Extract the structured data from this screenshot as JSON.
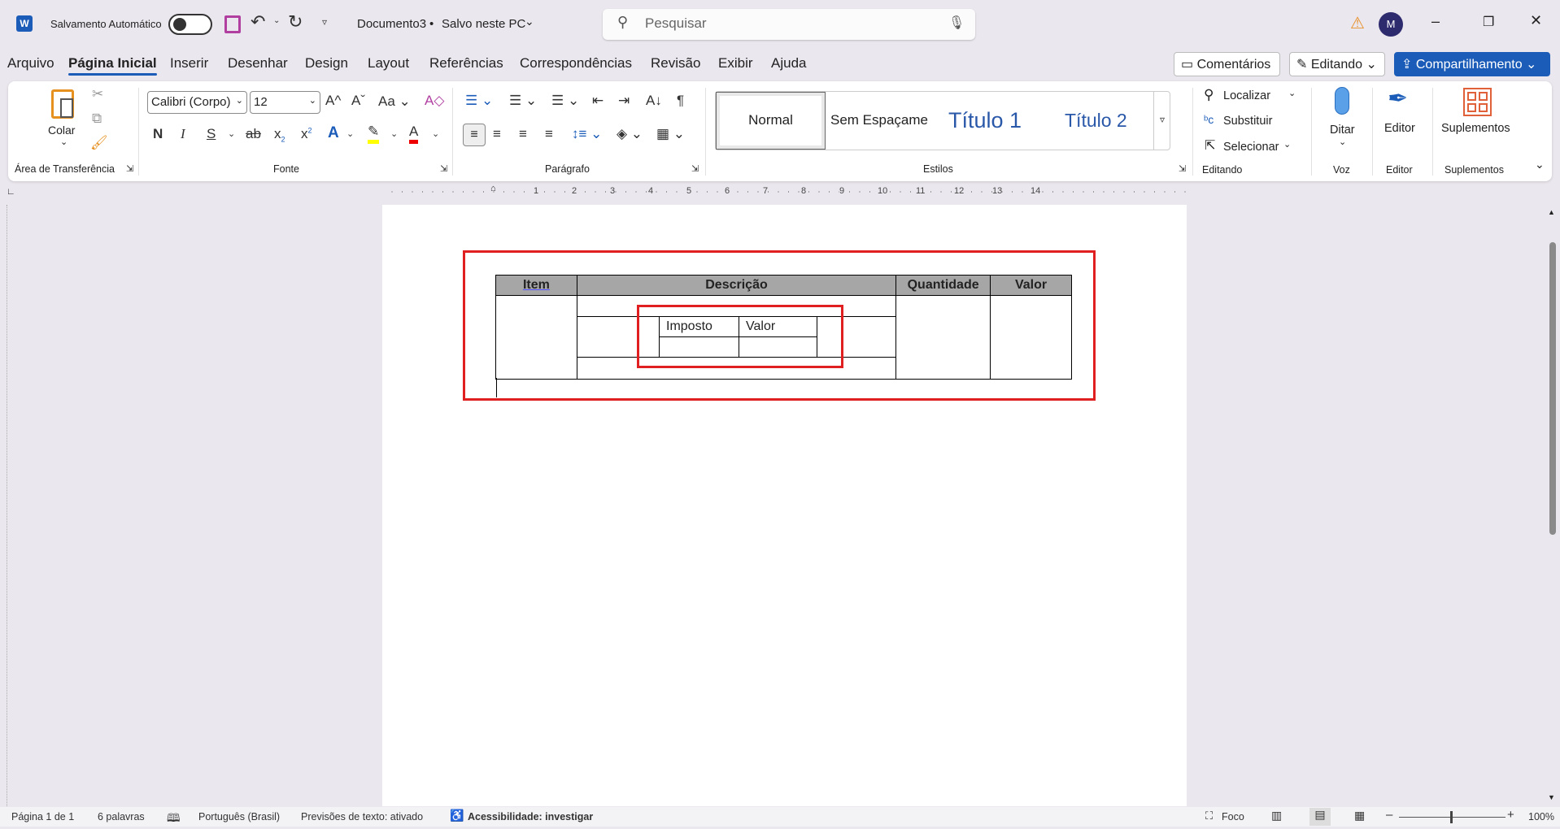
{
  "titlebar": {
    "autosave_label": "Salvamento Automático",
    "doc_title": "Documento3",
    "save_status": "Salvo neste PC",
    "search_placeholder": "Pesquisar",
    "avatar_initial": "M"
  },
  "tabs": [
    "Arquivo",
    "Página Inicial",
    "Inserir",
    "Desenhar",
    "Design",
    "Layout",
    "Referências",
    "Correspondências",
    "Revisão",
    "Exibir",
    "Ajuda"
  ],
  "actions": {
    "comments": "Comentários",
    "editing": "Editando",
    "share": "Compartilhamento"
  },
  "ribbon": {
    "clipboard": {
      "paste": "Colar",
      "group": "Área de Transferência"
    },
    "font": {
      "name": "Calibri (Corpo)",
      "size": "12",
      "group": "Fonte",
      "bold": "N",
      "italic": "I",
      "underline": "S",
      "change_case": "Aa"
    },
    "paragraph": {
      "group": "Parágrafo"
    },
    "styles": {
      "items": [
        "Normal",
        "Sem Espaçame",
        "Título 1",
        "Título 2"
      ],
      "group": "Estilos"
    },
    "editing": {
      "find": "Localizar",
      "replace": "Substituir",
      "select": "Selecionar",
      "group": "Editando"
    },
    "voice": {
      "dictate": "Ditar",
      "group": "Voz"
    },
    "editor": {
      "label": "Editor",
      "group": "Editor"
    },
    "addins": {
      "label": "Suplementos",
      "group": "Suplementos"
    },
    "accent": "#1b5cb8"
  },
  "ruler_numbers": [
    "1",
    "2",
    "3",
    "4",
    "5",
    "6",
    "7",
    "8",
    "9",
    "10",
    "11",
    "12",
    "13",
    "14"
  ],
  "document": {
    "table": {
      "headers": [
        "Item",
        "Descrição",
        "Quantidade",
        "Valor"
      ],
      "nested_headers": [
        "Imposto",
        "Valor"
      ]
    }
  },
  "status": {
    "page": "Página 1 de 1",
    "words": "6 palavras",
    "language": "Português (Brasil)",
    "predictions": "Previsões de texto: ativado",
    "accessibility": "Acessibilidade: investigar",
    "focus": "Foco",
    "zoom": "100%"
  }
}
